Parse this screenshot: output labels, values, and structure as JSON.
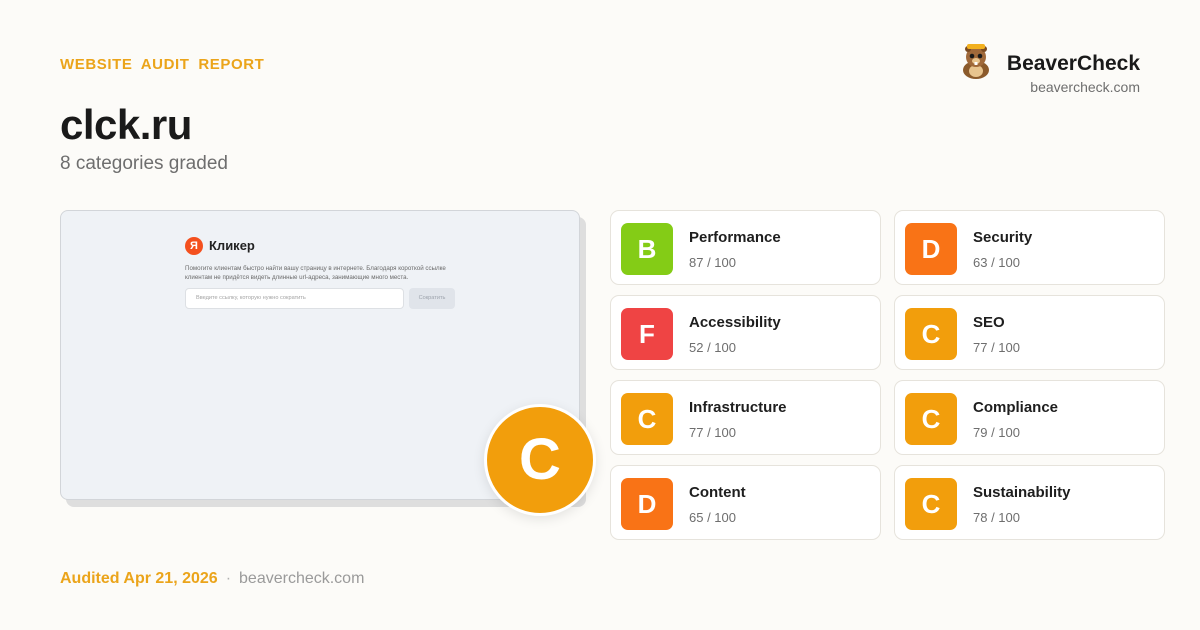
{
  "header": {
    "kicker": "WEBSITE AUDIT REPORT",
    "site": "clck.ru",
    "subtitle": "8 categories graded"
  },
  "brand": {
    "name": "BeaverCheck",
    "url": "beavercheck.com",
    "logo_icon": "beaver-mascot-icon"
  },
  "preview": {
    "logo_letter": "Я",
    "app_name": "Кликер",
    "description": "Помогите клиентам быстро найти вашу страницу в интернете. Благодаря короткой ссылке клиентам не придётся видеть длинные url-адреса, занимающие много места.",
    "input_placeholder": "Введите ссылку, которую нужно сократить",
    "button_label": "Сократить"
  },
  "overall_grade": {
    "letter": "C",
    "color": "#f29e0c"
  },
  "grade_colors": {
    "B": "#84cc16",
    "C": "#f29e0c",
    "D": "#f97316",
    "F": "#ef4444"
  },
  "categories": [
    {
      "name": "Performance",
      "grade": "B",
      "score": "87 / 100"
    },
    {
      "name": "Security",
      "grade": "D",
      "score": "63 / 100"
    },
    {
      "name": "Accessibility",
      "grade": "F",
      "score": "52 / 100"
    },
    {
      "name": "SEO",
      "grade": "C",
      "score": "77 / 100"
    },
    {
      "name": "Infrastructure",
      "grade": "C",
      "score": "77 / 100"
    },
    {
      "name": "Compliance",
      "grade": "C",
      "score": "79 / 100"
    },
    {
      "name": "Content",
      "grade": "D",
      "score": "65 / 100"
    },
    {
      "name": "Sustainability",
      "grade": "C",
      "score": "78 / 100"
    }
  ],
  "footer": {
    "date": "Audited Apr 21, 2026",
    "separator": "·",
    "url": "beavercheck.com"
  }
}
